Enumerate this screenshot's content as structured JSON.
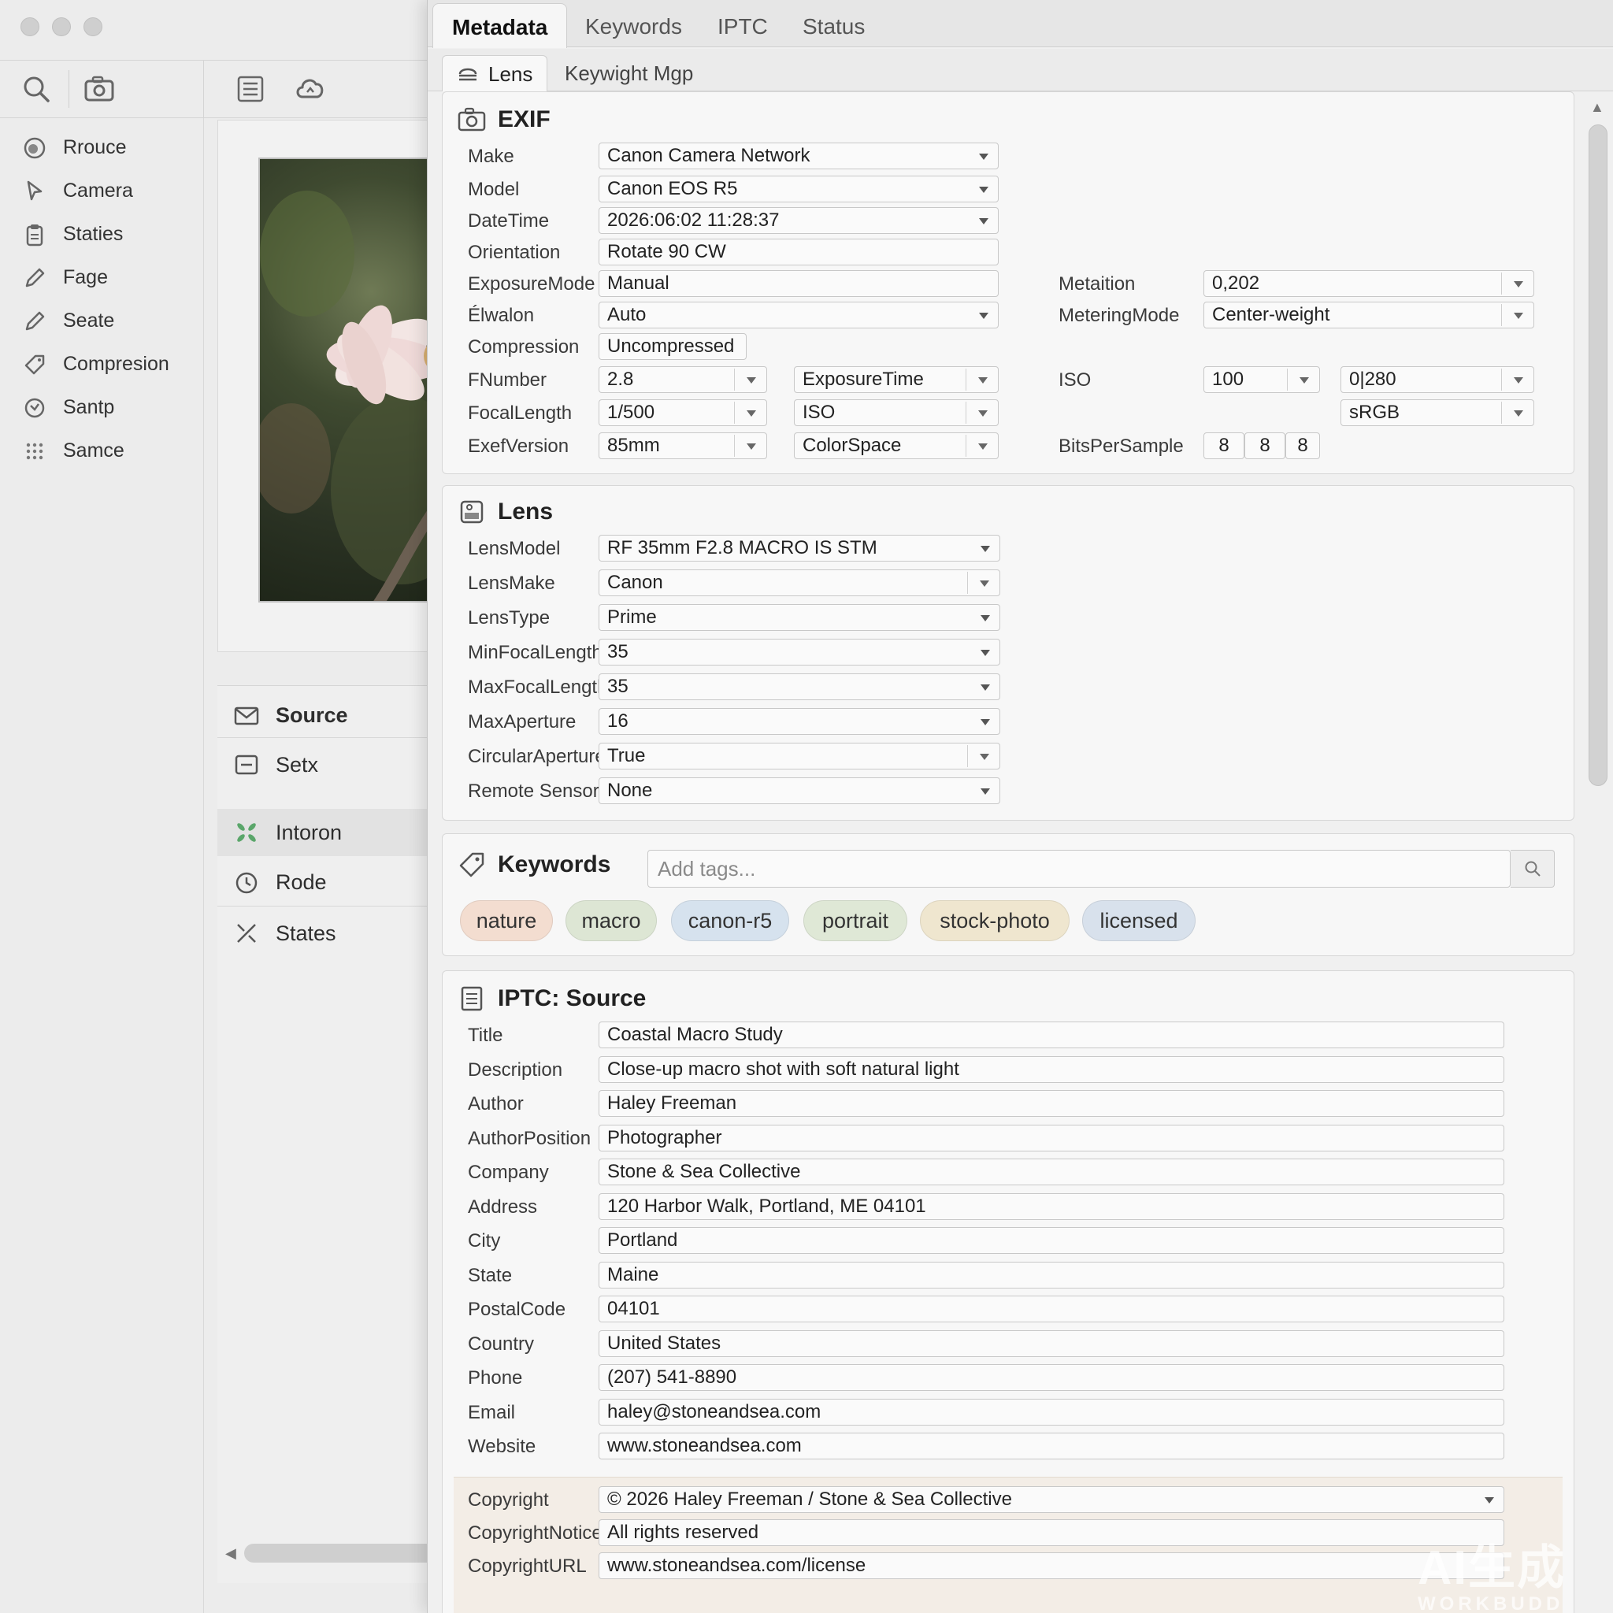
{
  "left": {
    "nav": [
      {
        "label": "Rrouce",
        "icon": "target-icon"
      },
      {
        "label": "Camera",
        "icon": "cursor-icon"
      },
      {
        "label": "Staties",
        "icon": "clipboard-icon"
      },
      {
        "label": "Fage",
        "icon": "pencil-icon"
      },
      {
        "label": "Seate",
        "icon": "pencil-icon"
      },
      {
        "label": "Compresion",
        "icon": "tag-icon"
      },
      {
        "label": "Santp",
        "icon": "refresh-icon"
      },
      {
        "label": "Samce",
        "icon": "grid-dots-icon"
      }
    ],
    "source_panel": {
      "title": "Source",
      "items": [
        {
          "label": "Setx"
        },
        {
          "label": "Intoron"
        },
        {
          "label": "Rode"
        },
        {
          "label": "States"
        }
      ]
    }
  },
  "tabs": [
    "Metadata",
    "Keywords",
    "IPTC",
    "Status"
  ],
  "subtabs": [
    "Lens",
    "Keywight Mgp"
  ],
  "exif": {
    "title": "EXIF",
    "make": {
      "label": "Make",
      "value": "Canon Camera Network"
    },
    "model": {
      "label": "Model",
      "value": "Canon EOS R5"
    },
    "datetime": {
      "label": "DateTime",
      "value": "2026:06:02 11:28:37"
    },
    "orientation": {
      "label": "Orientation",
      "value": "Rotate 90 CW"
    },
    "exposure_mode": {
      "label": "ExposureMode",
      "value": "Manual"
    },
    "elwalon": {
      "label": "Élwalon",
      "value": "Auto"
    },
    "compression": {
      "label": "Compression",
      "value": "Uncompressed"
    },
    "fnumber": {
      "label": "FNumber",
      "value": "2.8"
    },
    "focal_length": {
      "label": "FocalLength",
      "value": "1/500"
    },
    "exif_version": {
      "label": "ExefVersion",
      "value": "85mm"
    },
    "metaition": {
      "label": "Metaition",
      "value": "0,202"
    },
    "metering_mode": {
      "label": "MeteringMode",
      "value": "Center-weight"
    },
    "col2_exposure_time": "ExposureTime",
    "col2_iso": "ISO",
    "col2_colorspace": "ColorSpace",
    "iso": {
      "label": "ISO",
      "value": "100",
      "extra": "0|280"
    },
    "colorspace_value": "sRGB",
    "bits": {
      "label": "BitsPerSample",
      "v1": "8",
      "v2": "8",
      "v3": "8"
    }
  },
  "lens": {
    "title": "Lens",
    "rows": [
      {
        "label": "LensModel",
        "value": "RF 35mm F2.8 MACRO IS STM"
      },
      {
        "label": "LensMake",
        "value": "Canon"
      },
      {
        "label": "LensType",
        "value": "Prime"
      },
      {
        "label": "MinFocalLength",
        "value": "35"
      },
      {
        "label": "MaxFocalLength",
        "value": "35"
      },
      {
        "label": "MaxAperture",
        "value": "16"
      },
      {
        "label": "CircularAperture",
        "value": "True"
      },
      {
        "label": "Remote Sensor",
        "value": "None"
      }
    ]
  },
  "keywords": {
    "title": "Keywords",
    "placeholder": "Add tags...",
    "tags": [
      {
        "label": "nature",
        "color": "#f3ddd0"
      },
      {
        "label": "macro",
        "color": "#dde6d4"
      },
      {
        "label": "canon-r5",
        "color": "#d6e2ee"
      },
      {
        "label": "portrait",
        "color": "#dfe8d6"
      },
      {
        "label": "stock-photo",
        "color": "#efe6cf"
      },
      {
        "label": "licensed",
        "color": "#d8e1ec"
      }
    ]
  },
  "iptc": {
    "title": "IPTC: Source",
    "rows": [
      {
        "label": "Title",
        "value": "Coastal Macro Study"
      },
      {
        "label": "Description",
        "value": "Close-up macro shot with soft natural light"
      },
      {
        "label": "Author",
        "value": "Haley Freeman"
      },
      {
        "label": "AuthorPosition",
        "value": "Photographer"
      },
      {
        "label": "Company",
        "value": "Stone & Sea Collective"
      },
      {
        "label": "Address",
        "value": "120 Harbor Walk, Portland, ME 04101"
      },
      {
        "label": "City",
        "value": "Portland"
      },
      {
        "label": "State",
        "value": "Maine"
      },
      {
        "label": "PostalCode",
        "value": "04101"
      },
      {
        "label": "Country",
        "value": "United States"
      },
      {
        "label": "Phone",
        "value": "(207) 541-8890"
      },
      {
        "label": "Email",
        "value": "haley@stoneandsea.com"
      },
      {
        "label": "Website",
        "value": "www.stoneandsea.com"
      }
    ],
    "copyright": [
      {
        "label": "Copyright",
        "value": "© 2026 Haley Freeman / Stone & Sea Collective"
      },
      {
        "label": "CopyrightNotice",
        "value": "All rights reserved"
      },
      {
        "label": "CopyrightURL",
        "value": "www.stoneandsea.com/license"
      }
    ]
  },
  "watermark": {
    "main": "AI生成",
    "sub": "WORKBUDD"
  }
}
